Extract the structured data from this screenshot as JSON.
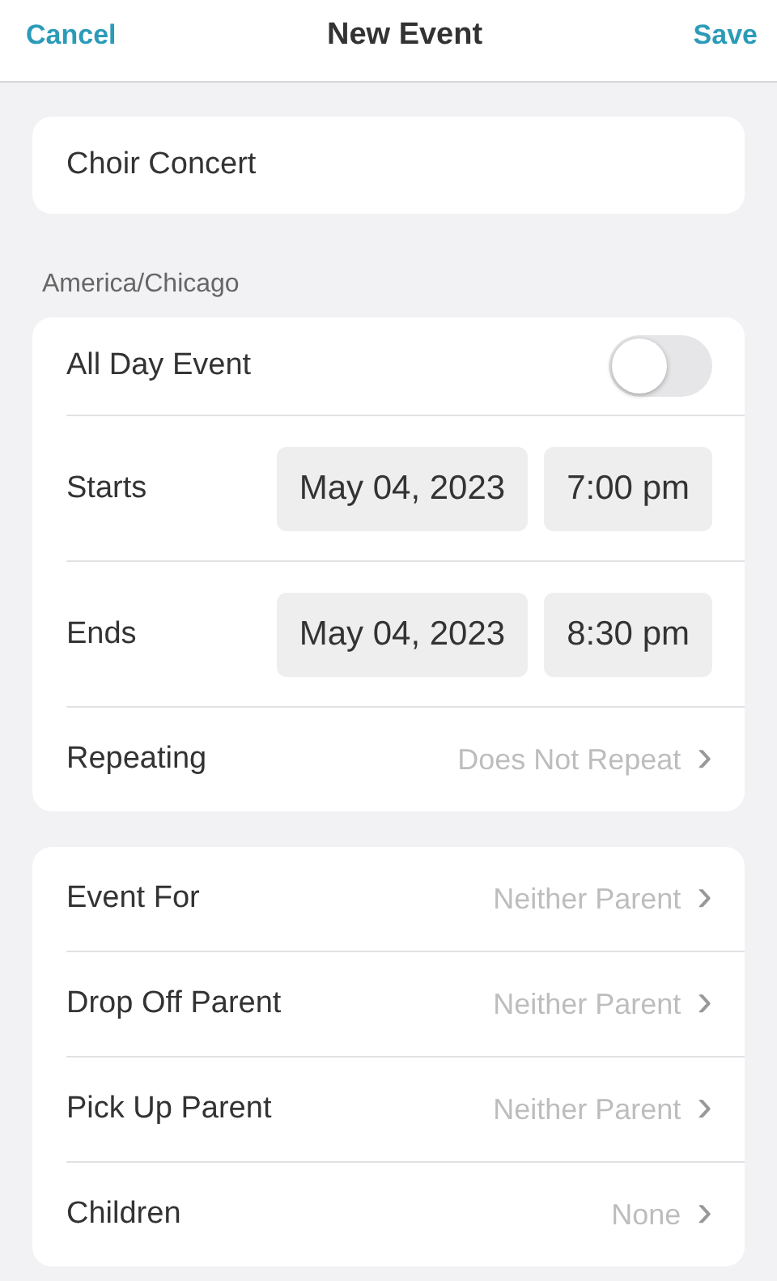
{
  "nav": {
    "cancel": "Cancel",
    "title": "New Event",
    "save": "Save"
  },
  "title_field": {
    "value": "Choir Concert"
  },
  "timezone": "America/Chicago",
  "schedule": {
    "all_day": {
      "label": "All Day Event",
      "on": false
    },
    "rows": [
      {
        "label": "Starts",
        "date": "May 04, 2023",
        "time": "7:00 pm"
      },
      {
        "label": "Ends",
        "date": "May 04, 2023",
        "time": "8:30 pm"
      }
    ],
    "repeating": {
      "label": "Repeating",
      "value": "Does Not Repeat",
      "chevron": "›"
    }
  },
  "assignments": [
    {
      "label": "Event For",
      "value": "Neither Parent",
      "chevron": "›"
    },
    {
      "label": "Drop Off Parent",
      "value": "Neither Parent",
      "chevron": "›"
    },
    {
      "label": "Pick Up Parent",
      "value": "Neither Parent",
      "chevron": "›"
    },
    {
      "label": "Children",
      "value": "None",
      "chevron": "›"
    }
  ]
}
